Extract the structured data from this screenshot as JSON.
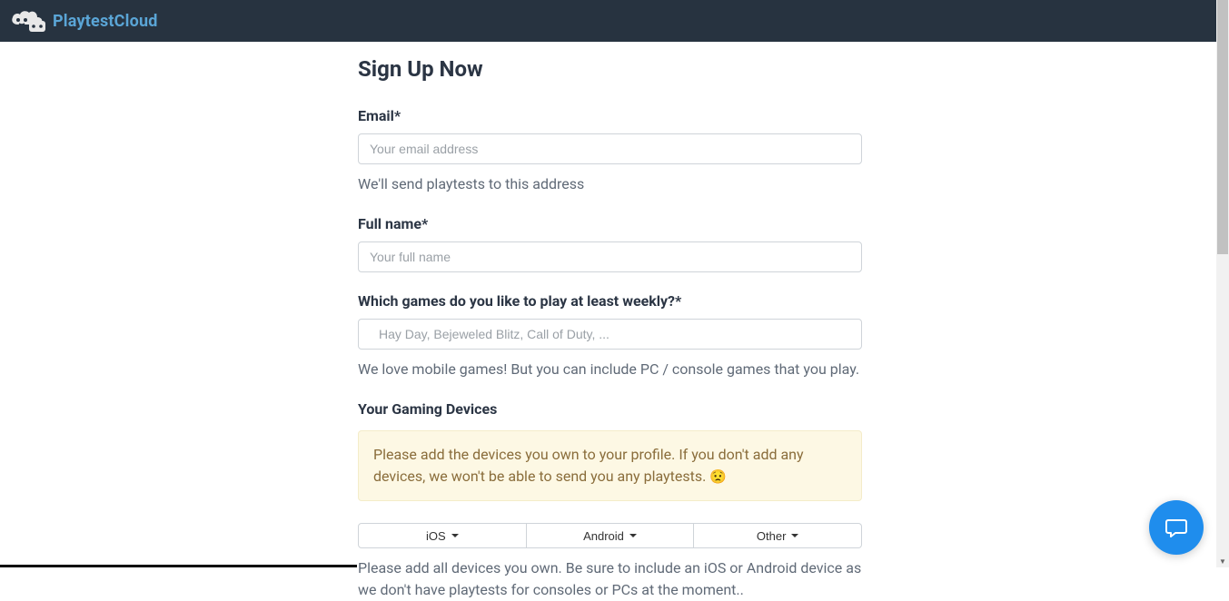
{
  "brand": "PlaytestCloud",
  "page": {
    "title": "Sign Up Now"
  },
  "form": {
    "email": {
      "label": "Email*",
      "placeholder": "Your email address",
      "help": "We'll send playtests to this address"
    },
    "fullname": {
      "label": "Full name*",
      "placeholder": "Your full name"
    },
    "games": {
      "label": "Which games do you like to play at least weekly?*",
      "placeholder": "Hay Day, Bejeweled Blitz, Call of Duty, ...",
      "help": "We love mobile games! But you can include PC / console games that you play."
    },
    "devices": {
      "label": "Your Gaming Devices",
      "alert": "Please add the devices you own to your profile. If you don't add any devices, we won't be able to send you any playtests. ",
      "emoji": "😟",
      "buttons": [
        "iOS",
        "Android",
        "Other"
      ],
      "help": "Please add all devices you own. Be sure to include an iOS or Android device as we don't have playtests for consoles or PCs at the moment.."
    }
  }
}
